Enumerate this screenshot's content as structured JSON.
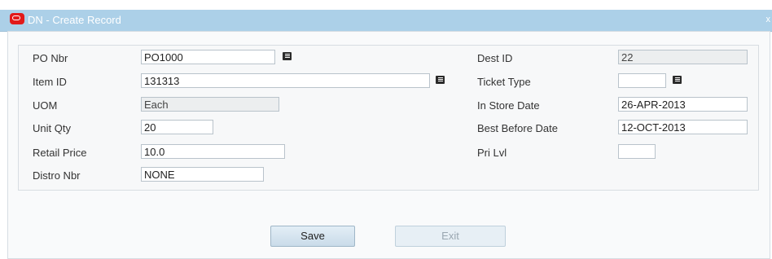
{
  "window": {
    "title": "DN - Create Record",
    "close_glyph": "x"
  },
  "form": {
    "po_nbr": {
      "label": "PO Nbr",
      "value": "PO1000",
      "lov_icon": "list-icon"
    },
    "item_id": {
      "label": "Item ID",
      "value": "131313",
      "lov_icon": "list-icon"
    },
    "uom": {
      "label": "UOM",
      "value": "Each"
    },
    "unit_qty": {
      "label": "Unit Qty",
      "value": "20"
    },
    "retail_price": {
      "label": "Retail Price",
      "value": "10.0"
    },
    "distro_nbr": {
      "label": "Distro Nbr",
      "value": "NONE"
    },
    "dest_id": {
      "label": "Dest ID",
      "value": "22"
    },
    "ticket_type": {
      "label": "Ticket Type",
      "value": "",
      "lov_icon": "list-icon"
    },
    "in_store_date": {
      "label": "In Store Date",
      "value": "26-APR-2013"
    },
    "best_before_date": {
      "label": "Best Before Date",
      "value": "12-OCT-2013"
    },
    "pri_lvl": {
      "label": "Pri Lvl",
      "value": ""
    }
  },
  "buttons": {
    "save": "Save",
    "exit": "Exit"
  },
  "colors": {
    "titlebar": "#acd0e8",
    "oracle_logo": "#e21a1a"
  }
}
